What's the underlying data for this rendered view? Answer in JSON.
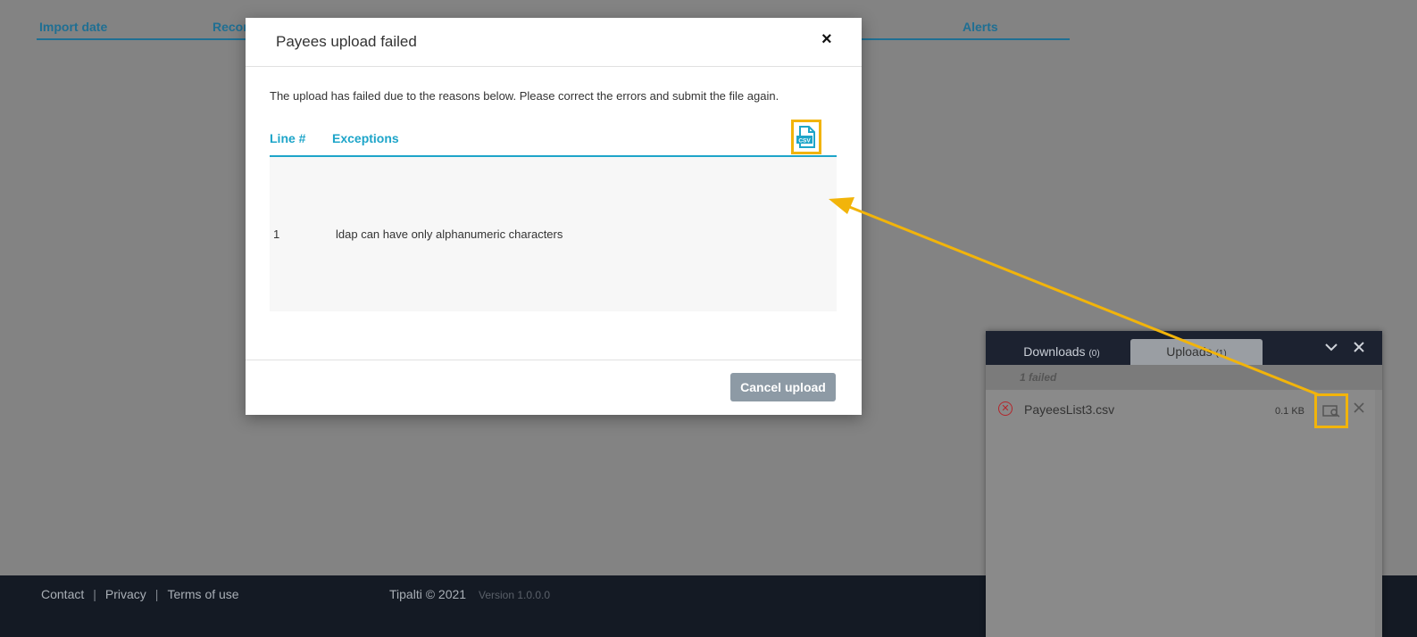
{
  "background": {
    "columns": [
      "Import date",
      "Recor",
      "Alerts"
    ]
  },
  "footer": {
    "links": [
      "Contact",
      "Privacy",
      "Terms of use"
    ],
    "separator": "|",
    "copyright": "Tipalti © 2021",
    "version": "Version 1.0.0.0"
  },
  "modal": {
    "title": "Payees upload failed",
    "close_icon": "×",
    "message": "The upload has failed due to the reasons below. Please correct the errors and submit the file again.",
    "table": {
      "headers": [
        "Line #",
        "Exceptions"
      ],
      "rows": [
        {
          "line": "1",
          "exception": "ldap can have only alphanumeric characters"
        }
      ]
    },
    "csv_icon_label": "CSV",
    "cancel_label": "Cancel upload"
  },
  "panel": {
    "tabs": [
      {
        "label": "Downloads",
        "count": "(0)"
      },
      {
        "label": "Uploads",
        "count": "(1)"
      }
    ],
    "status": "1 failed",
    "file": {
      "name": "PayeesList3.csv",
      "size": "0.1 KB"
    }
  },
  "colors": {
    "accent": "#1ea5c9",
    "highlight": "#f2b40a",
    "error": "#b4262b"
  },
  "icons": [
    "close-icon",
    "csv-file-icon",
    "chevron-down-icon",
    "close-panel-icon",
    "error-circle-icon",
    "preview-icon",
    "remove-icon"
  ]
}
